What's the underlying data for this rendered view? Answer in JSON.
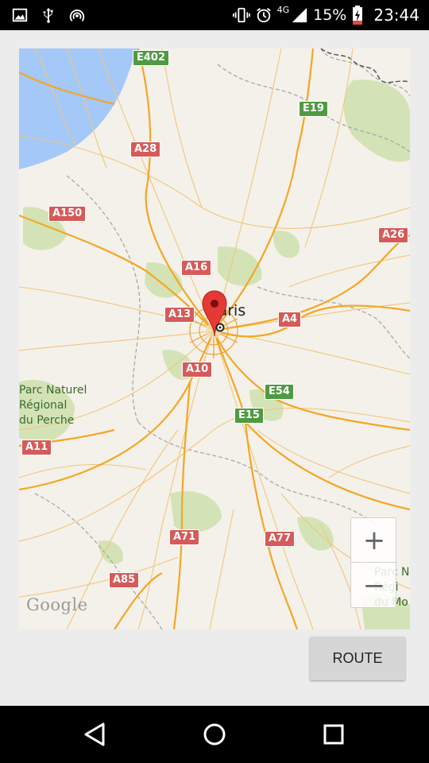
{
  "status_bar": {
    "network_type": "4G",
    "battery_percent": "15%",
    "time": "23:44",
    "icons_left": [
      "image-icon",
      "usb-icon",
      "hotspot-icon"
    ],
    "icons_right": [
      "vibrate-icon",
      "alarm-icon",
      "signal-icon",
      "battery-charging-icon"
    ]
  },
  "map": {
    "city_label": "Paris",
    "park_label_left": "Parc Naturel\nRégional\ndu Perche",
    "park_label_right": "Parc N\nRégi\ndu Mo",
    "google_logo": "Google",
    "road_badges": [
      {
        "label": "E402",
        "kind": "E"
      },
      {
        "label": "E19",
        "kind": "E"
      },
      {
        "label": "A28",
        "kind": "A"
      },
      {
        "label": "A150",
        "kind": "A"
      },
      {
        "label": "A26",
        "kind": "A"
      },
      {
        "label": "A16",
        "kind": "A"
      },
      {
        "label": "A13",
        "kind": "A"
      },
      {
        "label": "A4",
        "kind": "A"
      },
      {
        "label": "A10",
        "kind": "A"
      },
      {
        "label": "E54",
        "kind": "E"
      },
      {
        "label": "E15",
        "kind": "E"
      },
      {
        "label": "A11",
        "kind": "A"
      },
      {
        "label": "A71",
        "kind": "A"
      },
      {
        "label": "A77",
        "kind": "A"
      },
      {
        "label": "A85",
        "kind": "A"
      }
    ],
    "zoom_in_label": "+",
    "zoom_out_label": "−",
    "colors": {
      "land": "#f4f1ea",
      "sea": "#a4c8f8",
      "forest": "#cfe0b0",
      "roads": "#f5a623",
      "a_badge": "#d65a5a",
      "e_badge": "#4f9a42",
      "marker": "#e53935"
    }
  },
  "route_button": {
    "label": "ROUTE"
  },
  "nav_bar": {
    "back": "back-icon",
    "home": "home-icon",
    "recents": "recents-icon"
  }
}
